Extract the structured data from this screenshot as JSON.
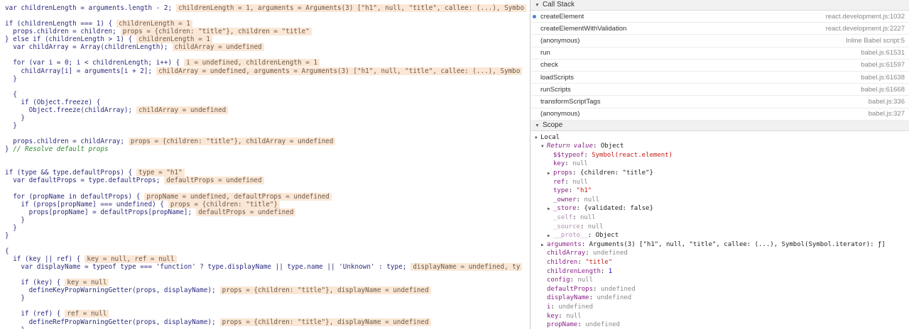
{
  "code_lines": [
    {
      "code": "var childrenLength = arguments.length - 2;",
      "ann": "childrenLength = 1, arguments = Arguments(3) [\"h1\", null, \"title\", callee: (...), Symbo"
    },
    {
      "code": "",
      "ann": ""
    },
    {
      "code": "if (childrenLength === 1) {",
      "ann": "childrenLength = 1"
    },
    {
      "code": "  props.children = children;",
      "ann": "props = {children: \"title\"}, children = \"title\""
    },
    {
      "code": "} else if (childrenLength > 1) {",
      "ann": "childrenLength = 1"
    },
    {
      "code": "  var childArray = Array(childrenLength);",
      "ann": "childArray = undefined"
    },
    {
      "code": "",
      "ann": ""
    },
    {
      "code": "  for (var i = 0; i < childrenLength; i++) {",
      "ann": "i = undefined, childrenLength = 1"
    },
    {
      "code": "    childArray[i] = arguments[i + 2];",
      "ann": "childArray = undefined, arguments = Arguments(3) [\"h1\", null, \"title\", callee: (...), Symbo"
    },
    {
      "code": "  }",
      "ann": ""
    },
    {
      "code": "",
      "ann": ""
    },
    {
      "code": "  {",
      "ann": ""
    },
    {
      "code": "    if (Object.freeze) {",
      "ann": ""
    },
    {
      "code": "      Object.freeze(childArray);",
      "ann": "childArray = undefined"
    },
    {
      "code": "    }",
      "ann": ""
    },
    {
      "code": "  }",
      "ann": ""
    },
    {
      "code": "",
      "ann": ""
    },
    {
      "code": "  props.children = childArray;",
      "ann": "props = {children: \"title\"}, childArray = undefined"
    },
    {
      "code": "} ",
      "ann": "",
      "comment": "// Resolve default props"
    },
    {
      "code": "",
      "ann": ""
    },
    {
      "code": "",
      "ann": ""
    },
    {
      "code": "if (type && type.defaultProps) {",
      "ann": "type = \"h1\""
    },
    {
      "code": "  var defaultProps = type.defaultProps;",
      "ann": "defaultProps = undefined"
    },
    {
      "code": "",
      "ann": ""
    },
    {
      "code": "  for (propName in defaultProps) {",
      "ann": "propName = undefined, defaultProps = undefined"
    },
    {
      "code": "    if (props[propName] === undefined) {",
      "ann": "props = {children: \"title\"}"
    },
    {
      "code": "      props[propName] = defaultProps[propName];",
      "ann": "defaultProps = undefined"
    },
    {
      "code": "    }",
      "ann": ""
    },
    {
      "code": "  }",
      "ann": ""
    },
    {
      "code": "}",
      "ann": ""
    },
    {
      "code": "",
      "ann": ""
    },
    {
      "code": "{",
      "ann": ""
    },
    {
      "code": "  if (key || ref) {",
      "ann": "key = null, ref = null"
    },
    {
      "code": "    var displayName = typeof type === 'function' ? type.displayName || type.name || 'Unknown' : type;",
      "ann": "displayName = undefined, ty"
    },
    {
      "code": "",
      "ann": ""
    },
    {
      "code": "    if (key) {",
      "ann": "key = null"
    },
    {
      "code": "      defineKeyPropWarningGetter(props, displayName);",
      "ann": "props = {children: \"title\"}, displayName = undefined"
    },
    {
      "code": "    }",
      "ann": ""
    },
    {
      "code": "",
      "ann": ""
    },
    {
      "code": "    if (ref) {",
      "ann": "ref = null"
    },
    {
      "code": "      defineRefPropWarningGetter(props, displayName);",
      "ann": "props = {children: \"title\"}, displayName = undefined"
    },
    {
      "code": "    }",
      "ann": ""
    }
  ],
  "call_stack": {
    "title": "Call Stack",
    "frames": [
      {
        "name": "createElement",
        "location": "react.development.js:1032",
        "current": true
      },
      {
        "name": "createElementWithValidation",
        "location": "react.development.js:2227"
      },
      {
        "name": "(anonymous)",
        "location": "Inline Babel script:5"
      },
      {
        "name": "run",
        "location": "babel.js:61531"
      },
      {
        "name": "check",
        "location": "babel.js:61597"
      },
      {
        "name": "loadScripts",
        "location": "babel.js:61638"
      },
      {
        "name": "runScripts",
        "location": "babel.js:61668"
      },
      {
        "name": "transformScriptTags",
        "location": "babel.js:336"
      },
      {
        "name": "(anonymous)",
        "location": "babel.js:327"
      }
    ]
  },
  "scope": {
    "title": "Scope",
    "rows": [
      {
        "depth": 0,
        "arrow": "down",
        "name": "Local",
        "value": "",
        "kind": "head"
      },
      {
        "depth": 1,
        "arrow": "down",
        "name": "Return value",
        "value": "Object",
        "kind": "it",
        "vkind": "obj"
      },
      {
        "depth": 2,
        "name": "$$typeof",
        "value": "Symbol(react.element)",
        "vkind": "str"
      },
      {
        "depth": 2,
        "name": "key",
        "value": "null"
      },
      {
        "depth": 2,
        "arrow": "right",
        "name": "props",
        "value": "{children: \"title\"}",
        "vkind": "obj"
      },
      {
        "depth": 2,
        "name": "ref",
        "value": "null"
      },
      {
        "depth": 2,
        "name": "type",
        "value": "\"h1\"",
        "vkind": "str"
      },
      {
        "depth": 2,
        "name": "_owner",
        "value": "null"
      },
      {
        "depth": 2,
        "arrow": "right",
        "name": "_store",
        "value": "{validated: false}",
        "vkind": "obj"
      },
      {
        "depth": 2,
        "name": "_self",
        "value": "null",
        "kind": "dim"
      },
      {
        "depth": 2,
        "name": "_source",
        "value": "null",
        "kind": "dim"
      },
      {
        "depth": 2,
        "arrow": "right",
        "name": "__proto__",
        "value": "Object",
        "kind": "dim",
        "vkind": "obj"
      },
      {
        "depth": 1,
        "arrow": "right",
        "name": "arguments",
        "value": "Arguments(3) [\"h1\", null, \"title\", callee: (...), Symbol(Symbol.iterator): ƒ]",
        "vkind": "obj"
      },
      {
        "depth": 1,
        "name": "childArray",
        "value": "undefined"
      },
      {
        "depth": 1,
        "name": "children",
        "value": "\"title\"",
        "vkind": "str"
      },
      {
        "depth": 1,
        "name": "childrenLength",
        "value": "1",
        "vkind": "num"
      },
      {
        "depth": 1,
        "name": "config",
        "value": "null"
      },
      {
        "depth": 1,
        "name": "defaultProps",
        "value": "undefined"
      },
      {
        "depth": 1,
        "name": "displayName",
        "value": "undefined"
      },
      {
        "depth": 1,
        "name": "i",
        "value": "undefined"
      },
      {
        "depth": 1,
        "name": "key",
        "value": "null"
      },
      {
        "depth": 1,
        "name": "propName",
        "value": "undefined"
      }
    ]
  }
}
